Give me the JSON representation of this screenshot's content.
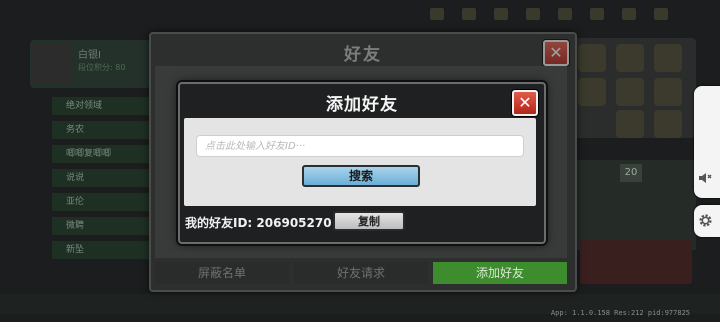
{
  "background": {
    "player_name": "白银I",
    "player_sub": "段位积分: 80",
    "list_items": [
      "绝对领域",
      "务农",
      "唧唧复唧唧",
      "说说",
      "亚伦",
      "微聘",
      "新坠"
    ],
    "counter": "20"
  },
  "friends_dialog": {
    "title": "好友",
    "close_symbol": "✕",
    "tabs": [
      {
        "label": "屏蔽名单"
      },
      {
        "label": "好友请求"
      },
      {
        "label": "添加好友"
      }
    ]
  },
  "add_friend_dialog": {
    "title": "添加好友",
    "close_symbol": "✕",
    "input_placeholder": "点击此处输入好友ID···",
    "input_value": "",
    "search_label": "搜索",
    "my_id_label": "我的好友ID:",
    "my_id_value": "206905270",
    "copy_label": "复制"
  },
  "side_buttons": {
    "sound_icon": "speaker-icon",
    "settings_icon": "gear-icon"
  },
  "status_text": "App: 1.1.0.158 Res:212 pid:977825",
  "colors": {
    "close_red": "#c8372a",
    "tab_active_green": "#3d8d2e",
    "search_blue": "#8cc3e3"
  }
}
